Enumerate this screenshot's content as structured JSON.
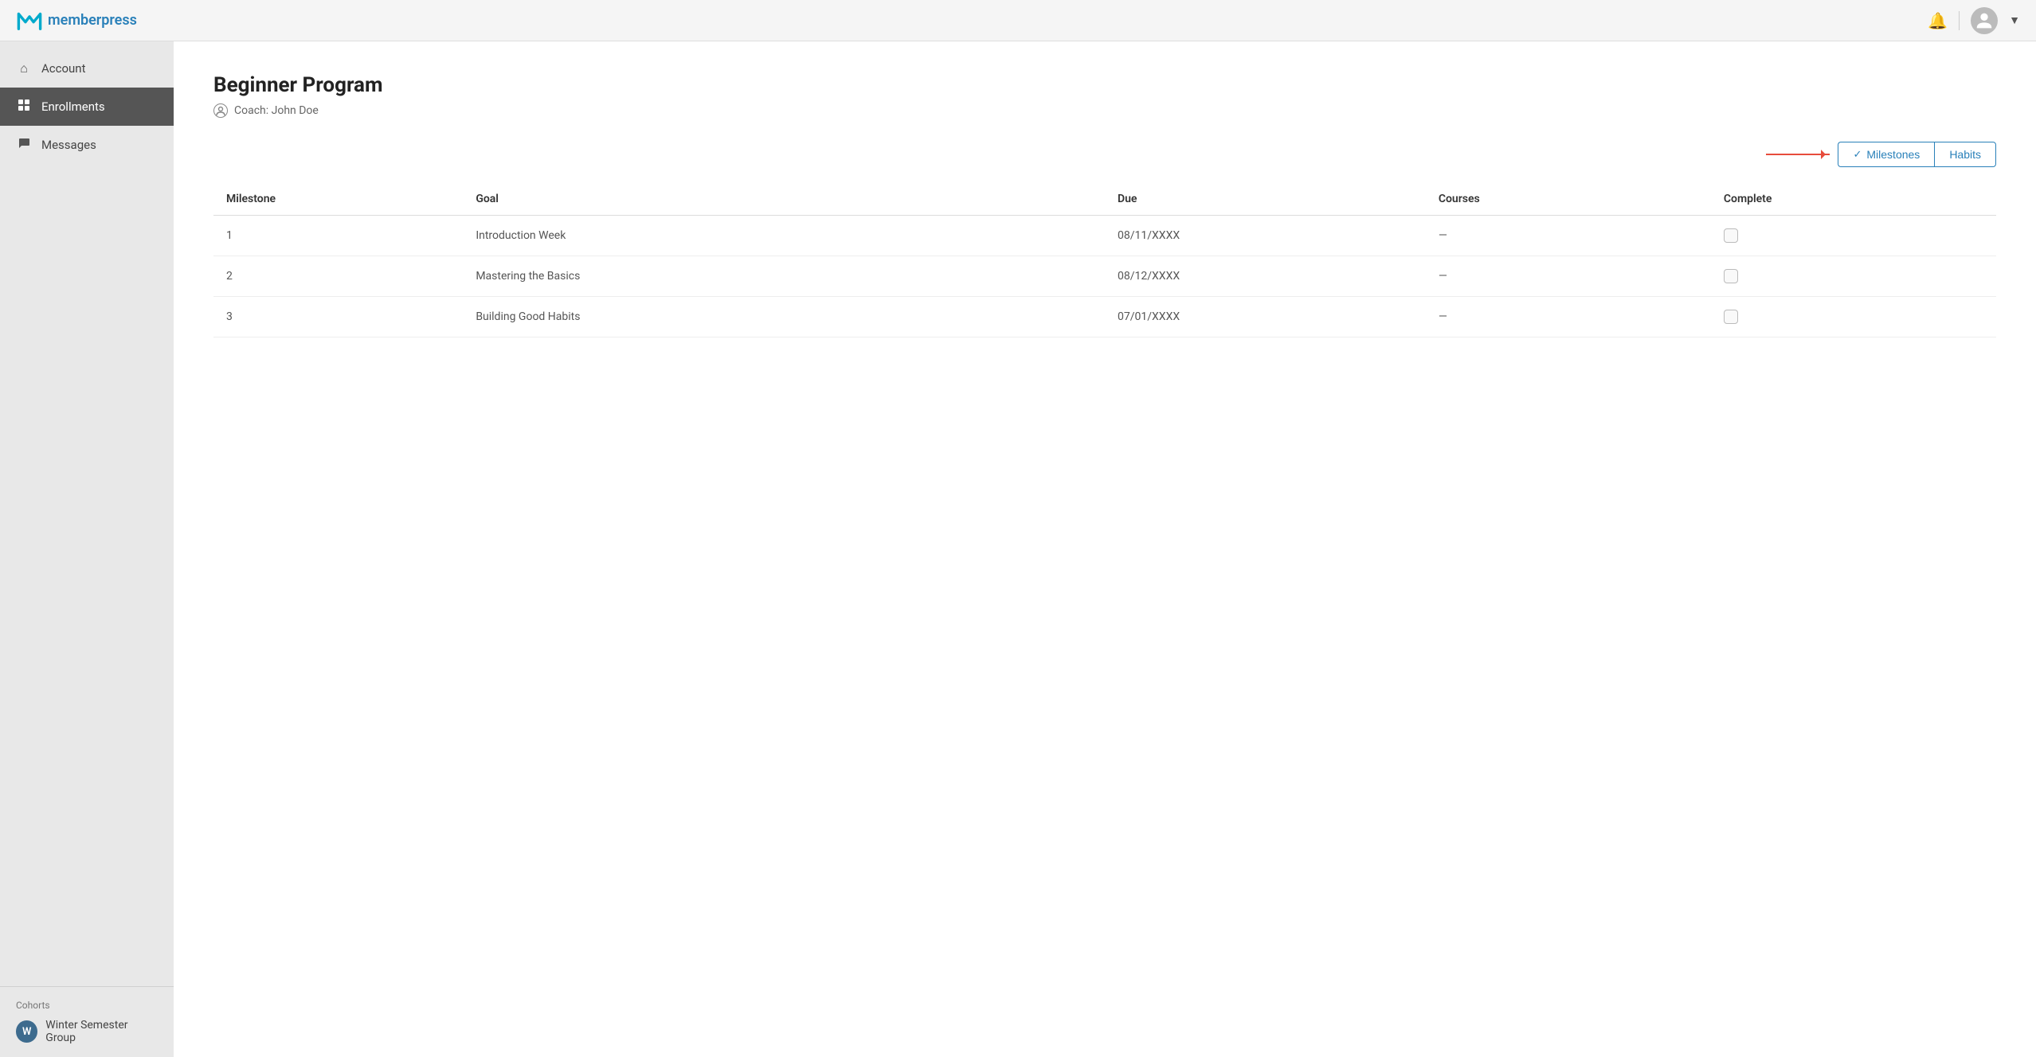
{
  "app": {
    "name": "memberpress",
    "logo_letter": "m"
  },
  "header": {
    "notification_title": "Notifications",
    "avatar_alt": "User avatar",
    "chevron_label": "expand user menu"
  },
  "sidebar": {
    "items": [
      {
        "id": "account",
        "label": "Account",
        "icon": "home"
      },
      {
        "id": "enrollments",
        "label": "Enrollments",
        "icon": "grid",
        "active": true
      },
      {
        "id": "messages",
        "label": "Messages",
        "icon": "chat"
      }
    ],
    "cohorts_label": "Cohorts",
    "cohort": {
      "initial": "W",
      "name": "Winter Semester Group"
    }
  },
  "page": {
    "title": "Beginner Program",
    "coach_label": "Coach: John Doe"
  },
  "tabs": [
    {
      "id": "milestones",
      "label": "Milestones",
      "active": true,
      "check": true
    },
    {
      "id": "habits",
      "label": "Habits",
      "active": false
    }
  ],
  "table": {
    "columns": [
      {
        "id": "milestone",
        "label": "Milestone"
      },
      {
        "id": "goal",
        "label": "Goal"
      },
      {
        "id": "due",
        "label": "Due"
      },
      {
        "id": "courses",
        "label": "Courses"
      },
      {
        "id": "complete",
        "label": "Complete"
      }
    ],
    "rows": [
      {
        "milestone": "1",
        "goal": "Introduction Week",
        "due": "08/11/XXXX",
        "courses": "—",
        "complete": false
      },
      {
        "milestone": "2",
        "goal": "Mastering the Basics",
        "due": "08/12/XXXX",
        "courses": "—",
        "complete": false
      },
      {
        "milestone": "3",
        "goal": "Building Good Habits",
        "due": "07/01/XXXX",
        "courses": "—",
        "complete": false
      }
    ]
  },
  "colors": {
    "accent": "#2980b9",
    "active_sidebar_bg": "#555555",
    "arrow_color": "#e74c3c"
  }
}
